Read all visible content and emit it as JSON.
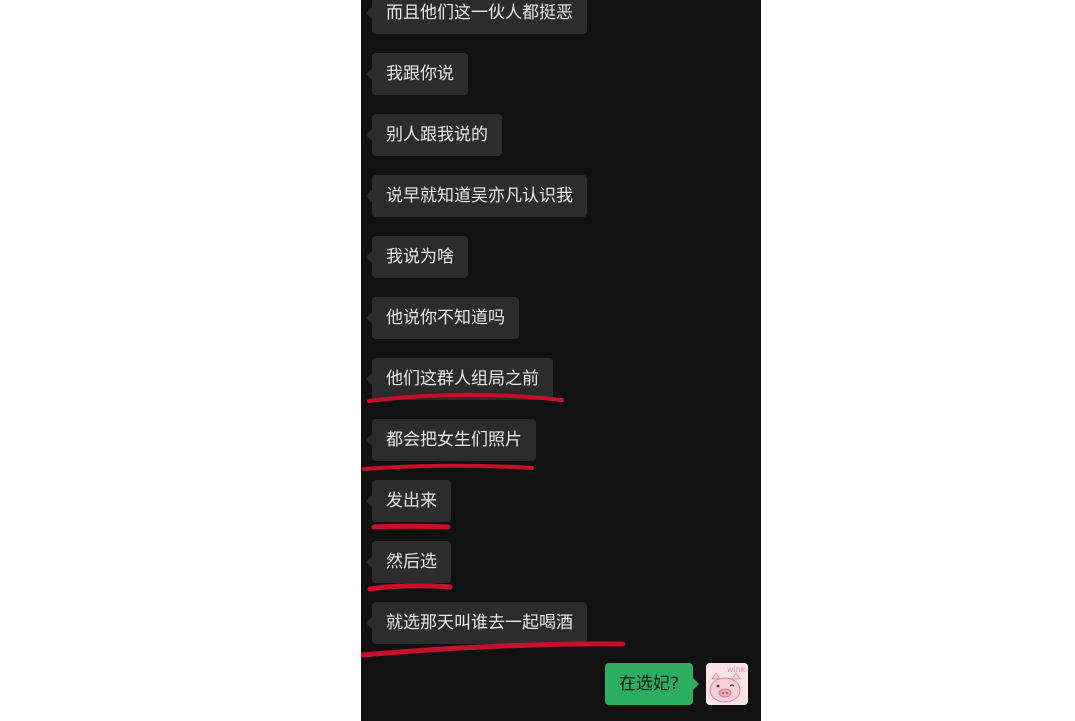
{
  "messages": [
    {
      "text": "而且他们这一伙人都挺恶",
      "side": "in"
    },
    {
      "text": "我跟你说",
      "side": "in"
    },
    {
      "text": "别人跟我说的",
      "side": "in"
    },
    {
      "text": "说早就知道吴亦凡认识我",
      "side": "in"
    },
    {
      "text": "我说为啥",
      "side": "in"
    },
    {
      "text": "他说你不知道吗",
      "side": "in"
    },
    {
      "text": "他们这群人组局之前",
      "side": "in"
    },
    {
      "text": "都会把女生们照片",
      "side": "in"
    },
    {
      "text": "发出来",
      "side": "in"
    },
    {
      "text": "然后选",
      "side": "in"
    },
    {
      "text": "就选那天叫谁去一起喝酒",
      "side": "in"
    },
    {
      "text": "在选妃?",
      "side": "out"
    }
  ],
  "avatar": {
    "sticker_text": "wink"
  },
  "colors": {
    "chat_bg": "#111111",
    "incoming_bubble": "#2c2c2c",
    "outgoing_bubble": "#2bae61",
    "annotation": "#c8102e"
  }
}
